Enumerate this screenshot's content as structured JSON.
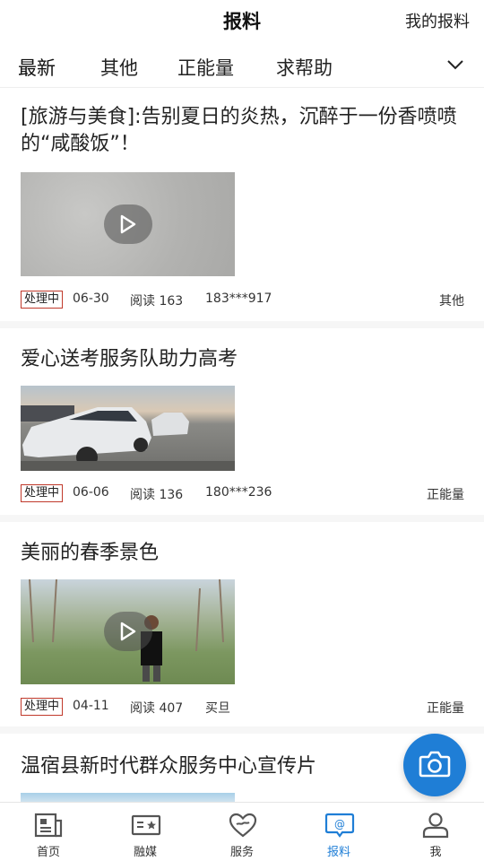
{
  "header": {
    "title": "报料",
    "my_report": "我的报料"
  },
  "tabs": [
    {
      "label": "最新"
    },
    {
      "label": "其他"
    },
    {
      "label": "正能量"
    },
    {
      "label": "求帮助"
    }
  ],
  "posts": [
    {
      "title": "[旅游与美食]:告别夏日的炎热，沉醉于一份香喷喷的“咸酸饭”！",
      "status": "处理中",
      "date": "06-30",
      "reads": "阅读 163",
      "user": "183***917",
      "category": "其他",
      "has_video": true
    },
    {
      "title": "爱心送考服务队助力高考",
      "status": "处理中",
      "date": "06-06",
      "reads": "阅读 136",
      "user": "180***236",
      "category": "正能量",
      "has_video": false
    },
    {
      "title": "美丽的春季景色",
      "status": "处理中",
      "date": "04-11",
      "reads": "阅读 407",
      "user": "买旦",
      "category": "正能量",
      "has_video": true
    },
    {
      "title": "温宿县新时代群众服务中心宣传片"
    }
  ],
  "bottom_nav": [
    {
      "label": "首页",
      "icon": "news-icon"
    },
    {
      "label": "融媒",
      "icon": "media-icon"
    },
    {
      "label": "服务",
      "icon": "heart-service-icon"
    },
    {
      "label": "报料",
      "icon": "report-chat-icon"
    },
    {
      "label": "我",
      "icon": "user-icon"
    }
  ],
  "colors": {
    "accent": "#1f7ed6",
    "badge_border": "#c0392b"
  }
}
